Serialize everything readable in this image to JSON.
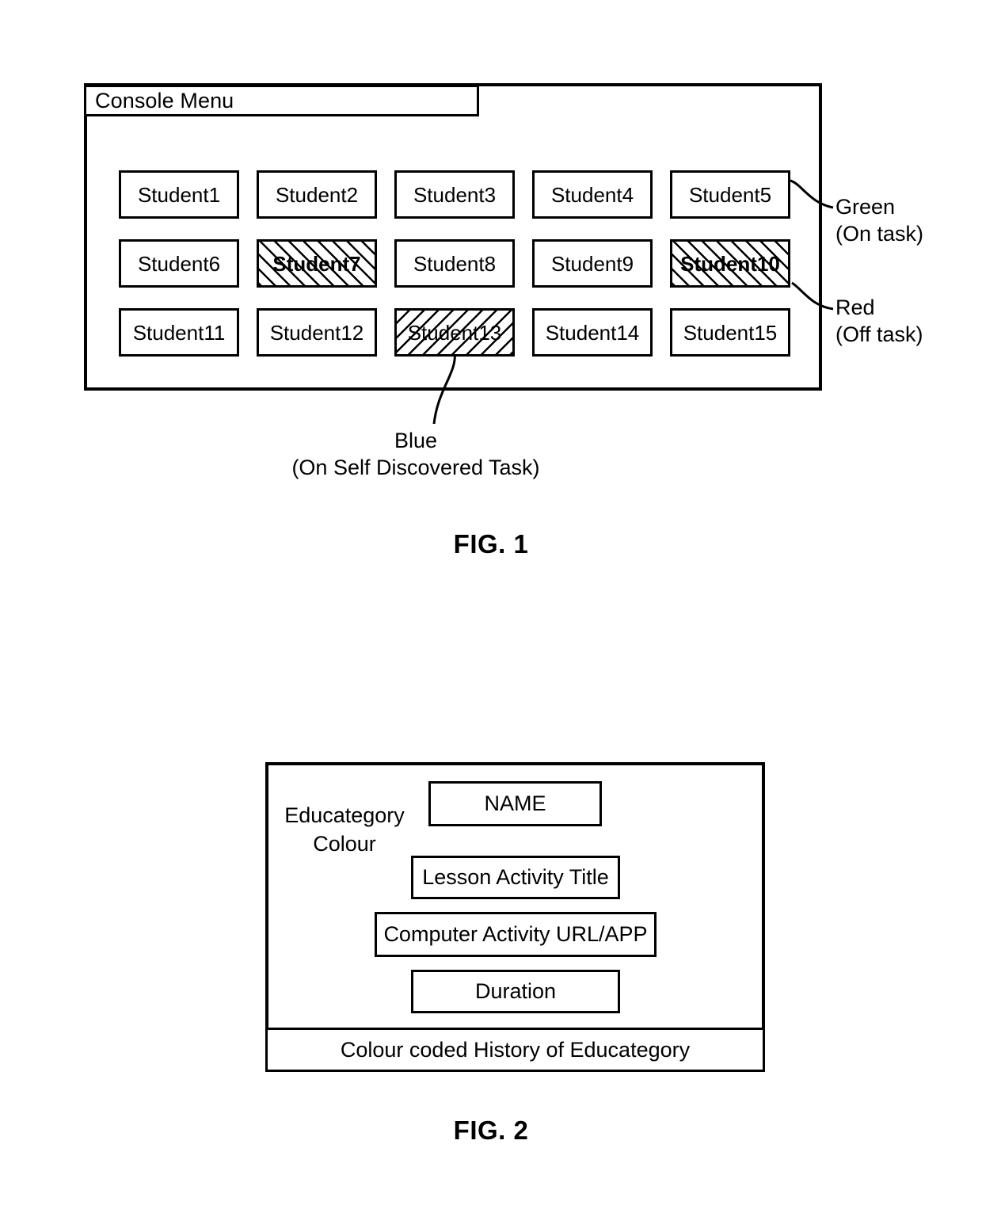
{
  "figure1": {
    "caption": "FIG. 1",
    "console_menu_label": "Console Menu",
    "students": [
      {
        "label": "Student1",
        "state": "none",
        "hatch": "none",
        "bold": false
      },
      {
        "label": "Student2",
        "state": "none",
        "hatch": "none",
        "bold": false
      },
      {
        "label": "Student3",
        "state": "none",
        "hatch": "none",
        "bold": false
      },
      {
        "label": "Student4",
        "state": "none",
        "hatch": "none",
        "bold": false
      },
      {
        "label": "Student5",
        "state": "green",
        "hatch": "none",
        "bold": false
      },
      {
        "label": "Student6",
        "state": "none",
        "hatch": "none",
        "bold": false
      },
      {
        "label": "Student7",
        "state": "red",
        "hatch": "forward",
        "bold": true
      },
      {
        "label": "Student8",
        "state": "none",
        "hatch": "none",
        "bold": false
      },
      {
        "label": "Student9",
        "state": "none",
        "hatch": "none",
        "bold": false
      },
      {
        "label": "Student10",
        "state": "red",
        "hatch": "forward",
        "bold": true
      },
      {
        "label": "Student11",
        "state": "none",
        "hatch": "none",
        "bold": false
      },
      {
        "label": "Student12",
        "state": "none",
        "hatch": "none",
        "bold": false
      },
      {
        "label": "Student13",
        "state": "blue",
        "hatch": "backward",
        "bold": false
      },
      {
        "label": "Student14",
        "state": "none",
        "hatch": "none",
        "bold": false
      },
      {
        "label": "Student15",
        "state": "none",
        "hatch": "none",
        "bold": false
      }
    ],
    "annotations": {
      "green": {
        "colour": "Green",
        "meaning": "(On task)",
        "target": "Student5"
      },
      "red": {
        "colour": "Red",
        "meaning": "(Off task)",
        "target": "Student10"
      },
      "blue": {
        "colour": "Blue",
        "meaning": "(On Self Discovered Task)",
        "target": "Student13"
      }
    }
  },
  "figure2": {
    "caption": "FIG. 2",
    "side_label_line1": "Educategory",
    "side_label_line2": "Colour",
    "fields": {
      "name": "NAME",
      "lesson_activity_title": "Lesson Activity Title",
      "computer_activity": "Computer Activity URL/APP",
      "duration": "Duration"
    },
    "history_strip": "Colour coded History of Educategory"
  }
}
